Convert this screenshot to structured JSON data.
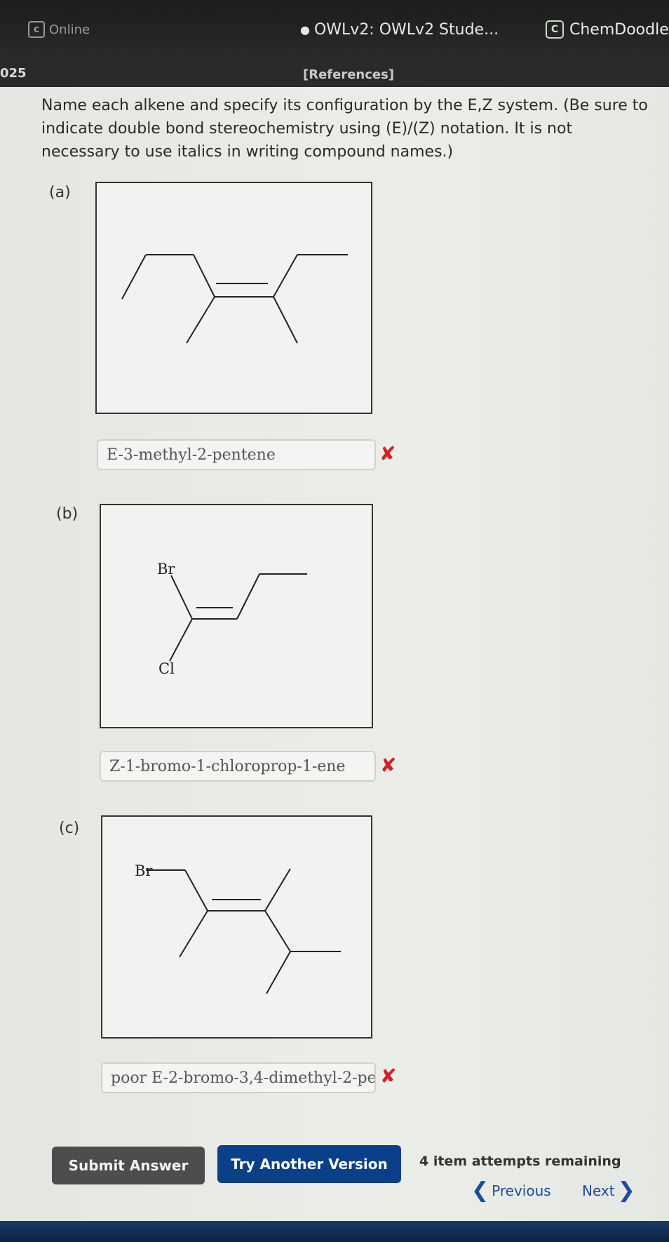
{
  "browser": {
    "tab_online": "Online",
    "tab_owl": "OWLv2: OWLv2 Stude...",
    "tab_chem": "ChemDoodle"
  },
  "header": {
    "year": "025",
    "references": "[References]"
  },
  "question": {
    "instructions": "Name each alkene and specify its configuration by the E,Z system. (Be sure to indicate double bond stereochemistry using (E)/(Z) notation. It is not necessary to use italics in writing compound names.)"
  },
  "parts": [
    {
      "label": "(a)",
      "answer": "E-3-methyl-2-pentene",
      "status": "incorrect"
    },
    {
      "label": "(b)",
      "answer": "Z-1-bromo-1-chloroprop-1-ene",
      "status": "incorrect",
      "atom_labels": [
        "Br",
        "Cl"
      ]
    },
    {
      "label": "(c)",
      "answer": "poor E-2-bromo-3,4-dimethyl-2-pe",
      "status": "incorrect",
      "atom_labels": [
        "Br"
      ]
    }
  ],
  "actions": {
    "submit": "Submit Answer",
    "try_another": "Try Another Version",
    "attempts": "4 item attempts remaining",
    "previous": "Previous",
    "next": "Next"
  },
  "status_icons": {
    "incorrect": "x-mark-icon"
  },
  "colors": {
    "accent": "#0b3f87",
    "error": "#d81f26",
    "submit_bg": "#4d4d4d"
  }
}
